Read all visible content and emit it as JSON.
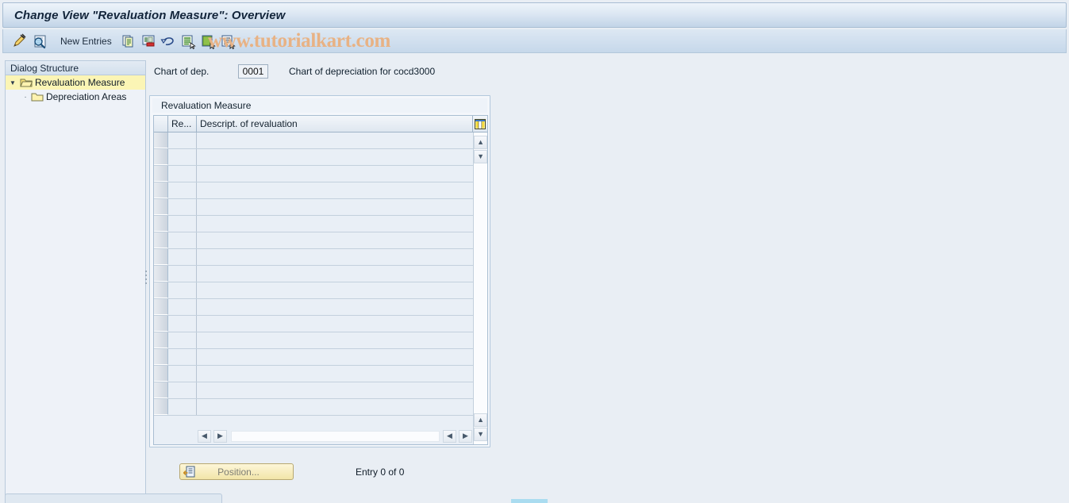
{
  "window": {
    "title": "Change View \"Revaluation Measure\": Overview"
  },
  "toolbar": {
    "icons": [
      {
        "name": "display-change-icon",
        "title": "Display/Change"
      },
      {
        "name": "check-entries-icon",
        "title": "Check Entries"
      }
    ],
    "new_entries_label": "New Entries",
    "action_icons": [
      {
        "name": "copy-as-icon",
        "title": "Copy As..."
      },
      {
        "name": "delete-icon",
        "title": "Delete"
      },
      {
        "name": "undo-icon",
        "title": "Undo Change"
      },
      {
        "name": "select-all-icon",
        "title": "Select All"
      },
      {
        "name": "deselect-all-icon",
        "title": "Deselect All"
      },
      {
        "name": "select-block-icon",
        "title": "Select Block"
      }
    ]
  },
  "watermark": {
    "text": "www.tutorialkart.com",
    "color": "#e8b284"
  },
  "sidebar": {
    "header": "Dialog Structure",
    "items": [
      {
        "label": "Revaluation Measure",
        "selected": true,
        "level": 0
      },
      {
        "label": "Depreciation Areas",
        "selected": false,
        "level": 1
      }
    ]
  },
  "content": {
    "chart_of_dep_label": "Chart of dep.",
    "chart_of_dep_value": "0001",
    "chart_of_dep_description": "Chart of depreciation for cocd3000"
  },
  "table": {
    "caption": "Revaluation Measure",
    "columns": [
      {
        "key": "selector",
        "label": ""
      },
      {
        "key": "re",
        "label": "Re..."
      },
      {
        "key": "descript",
        "label": "Descript. of revaluation"
      }
    ],
    "config_icon": "table-settings-icon",
    "rows": [],
    "empty_row_count": 17
  },
  "footer": {
    "position_button_label": "Position...",
    "position_button_icon": "position-icon",
    "entry_count": "Entry 0 of 0"
  },
  "colors": {
    "accent": "#aadcf0",
    "selection": "#fbf5b5",
    "titlebar_text": "#12243a"
  }
}
